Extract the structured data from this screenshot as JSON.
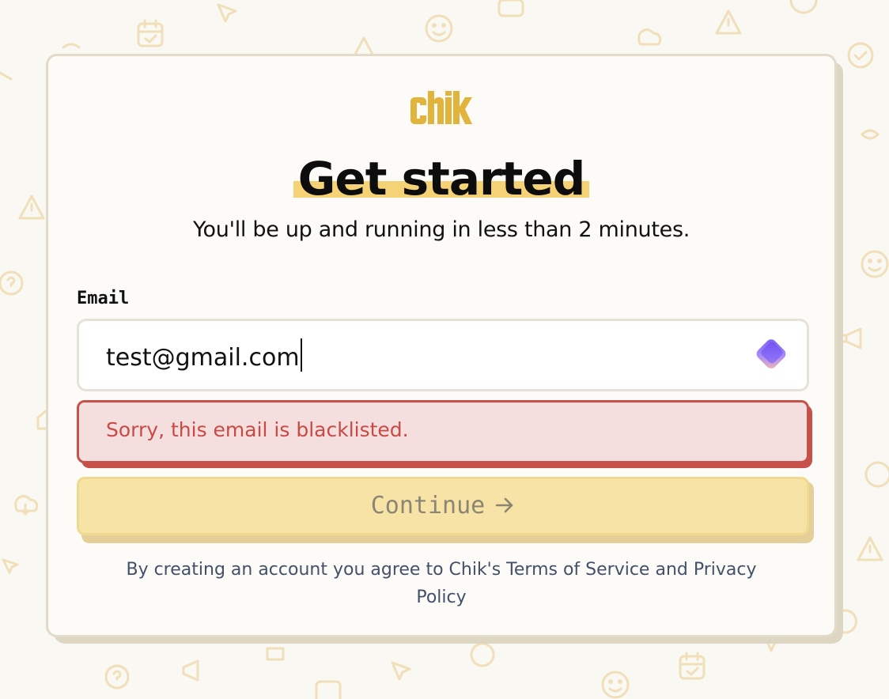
{
  "brand": {
    "logo_text": "chik",
    "logo_color": "#e3b43c"
  },
  "header": {
    "title": "Get started",
    "subtitle": "You'll be up and running in less than 2 minutes."
  },
  "form": {
    "email_label": "Email",
    "email_value": "test@gmail.com",
    "error_message": "Sorry, this email is blacklisted.",
    "continue_label": "Continue"
  },
  "legal": {
    "text": "By creating an account you agree to Chik's Terms of Service and Privacy Policy"
  },
  "icons": {
    "password_manager": "diamond-gradient-icon",
    "continue_arrow": "arrow-right-icon",
    "background": [
      "smiley-icon",
      "triangle-warning-icon",
      "calendar-icon",
      "cursor-arrow-icon",
      "question-bubble-icon",
      "megaphone-icon",
      "cloud-download-icon",
      "badge-check-icon"
    ]
  },
  "colors": {
    "accent_yellow": "#f6d276",
    "error_red": "#c8504a",
    "error_bg": "#f5dede",
    "background": "#faf8f3"
  }
}
